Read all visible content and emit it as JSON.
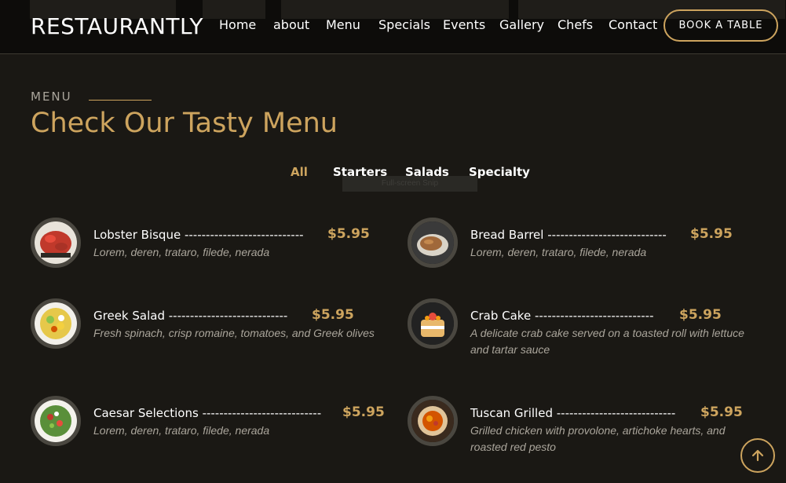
{
  "header": {
    "logo": "RESTAURANTLY",
    "nav": [
      "Home",
      "about",
      "Menu",
      "Specials",
      "Events",
      "Gallery",
      "Chefs",
      "Contact"
    ],
    "book_label": "BOOK A TABLE"
  },
  "section": {
    "eyebrow": "MENU",
    "title": "Check Our Tasty Menu"
  },
  "filters": [
    "All",
    "Starters",
    "Salads",
    "Specialty"
  ],
  "tooltip": "Full-screen Snip",
  "items": [
    {
      "name": "Lobster Bisque",
      "dots": "----------------------------",
      "price": "$5.95",
      "desc": "Lorem, deren, trataro, filede, nerada",
      "icon": "lobster-image"
    },
    {
      "name": "Bread Barrel",
      "dots": "----------------------------",
      "price": "$5.95",
      "desc": "Lorem, deren, trataro, filede, nerada",
      "icon": "bread-image"
    },
    {
      "name": "Greek Salad",
      "dots": "----------------------------",
      "price": "$5.95",
      "desc": "Fresh spinach, crisp romaine, tomatoes, and Greek olives",
      "icon": "salad-image"
    },
    {
      "name": "Crab Cake",
      "dots": "----------------------------",
      "price": "$5.95",
      "desc": "A delicate crab cake served on a toasted roll with lettuce and tartar sauce",
      "icon": "cake-image"
    },
    {
      "name": "Caesar Selections",
      "dots": "----------------------------",
      "price": "$5.95",
      "desc": "Lorem, deren, trataro, filede, nerada",
      "icon": "caesar-image"
    },
    {
      "name": "Tuscan Grilled",
      "dots": "----------------------------",
      "price": "$5.95",
      "desc": "Grilled chicken with provolone, artichoke hearts, and roasted red pesto",
      "icon": "tuscan-image"
    }
  ],
  "colors": {
    "accent": "#cda45e",
    "background": "#1a1814",
    "muted": "#aaa59b"
  }
}
